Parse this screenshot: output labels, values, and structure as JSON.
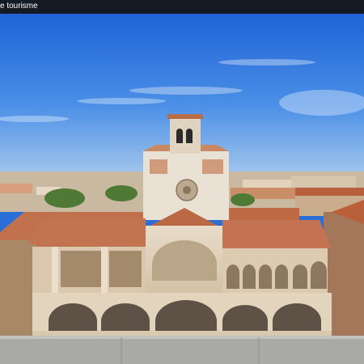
{
  "header": {
    "title": "e tourisme"
  },
  "photo": {
    "subject": "bell-tower-palace-courtyard"
  }
}
